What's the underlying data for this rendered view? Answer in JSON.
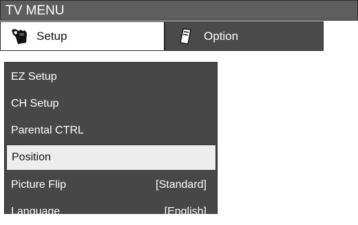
{
  "title": "TV MENU",
  "tabs": [
    {
      "label": "Setup",
      "icon": "hand-tool-icon",
      "active": true
    },
    {
      "label": "Option",
      "icon": "remote-icon",
      "active": false
    }
  ],
  "menu": {
    "items": [
      {
        "label": "EZ Setup",
        "value": ""
      },
      {
        "label": "CH Setup",
        "value": ""
      },
      {
        "label": "Parental CTRL",
        "value": ""
      },
      {
        "label": "Position",
        "value": "",
        "selected": true
      },
      {
        "label": "Picture Flip",
        "value": "[Standard]"
      },
      {
        "label": "Language",
        "value": "[English]"
      }
    ]
  },
  "colors": {
    "title_bar": "#5e5e5e",
    "menu_bg": "#474747",
    "selected_bg": "#ededed"
  }
}
